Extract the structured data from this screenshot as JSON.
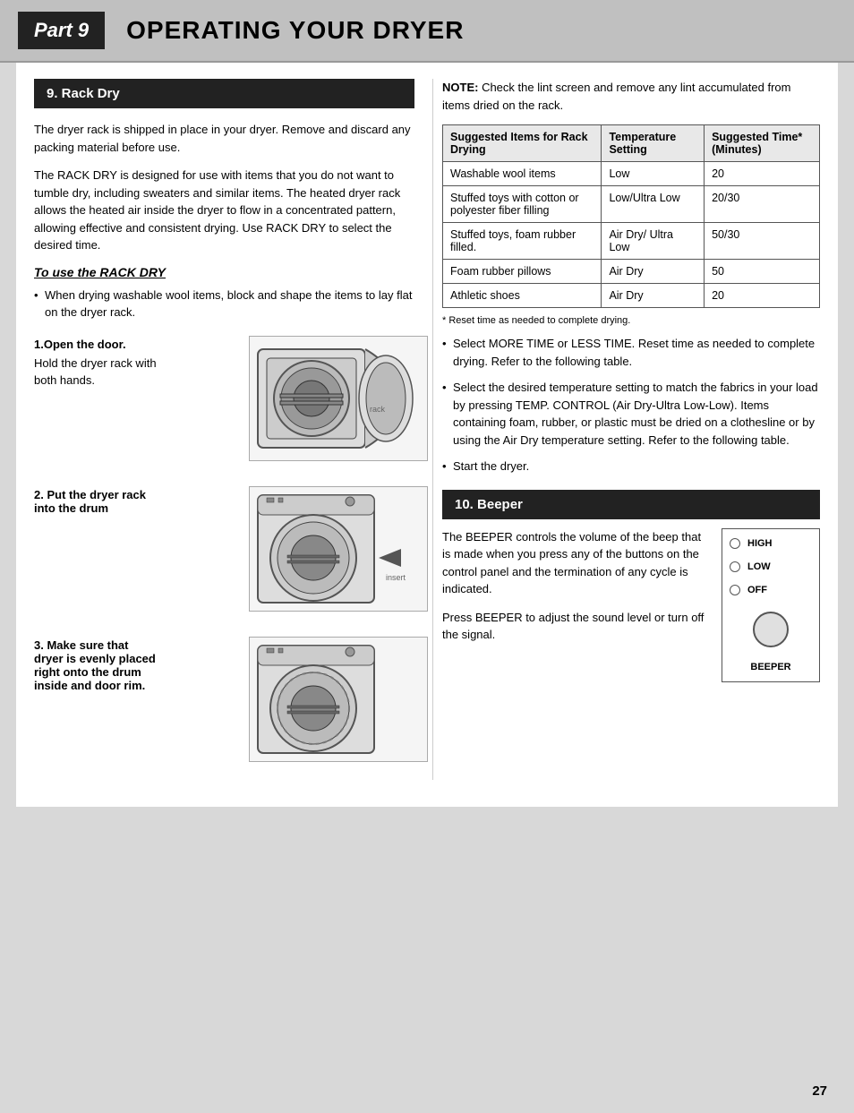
{
  "header": {
    "part_label": "Part 9",
    "title": "OPERATING YOUR DRYER"
  },
  "section1": {
    "heading": "9. Rack Dry",
    "para1": "The dryer rack is shipped in place in your dryer. Remove and discard any packing material before use.",
    "para2": "The RACK DRY is designed for use with items that you do not want to tumble dry, including sweaters and similar items.  The heated dryer rack allows the heated air inside the dryer to flow in a concentrated pattern, allowing effective and consistent drying. Use RACK DRY to select the desired time.",
    "use_heading": "To use the RACK DRY",
    "bullet1": "When drying washable wool items, block and shape the items to lay flat on the dryer rack.",
    "step1_label": "1.Open the door.",
    "step1_text": "Hold the dryer rack with both hands.",
    "step2_label": "2. Put the dryer rack into the drum",
    "step3_label": "3. Make sure that dryer is evenly placed right onto the drum inside and door rim."
  },
  "right_col": {
    "note_bold": "NOTE:",
    "note_text": " Check the lint screen and remove any lint accumulated from items dried on the rack.",
    "table": {
      "col1": "Suggested Items for Rack Drying",
      "col2": "Temperature Setting",
      "col3": "Suggested Time* (Minutes)",
      "rows": [
        {
          "item": "Washable wool items",
          "temp": "Low",
          "time": "20"
        },
        {
          "item": "Stuffed toys with cotton or polyester fiber filling",
          "temp": "Low/Ultra Low",
          "time": "20/30"
        },
        {
          "item": "Stuffed toys, foam rubber filled.",
          "temp": "Air Dry/ Ultra Low",
          "time": "50/30"
        },
        {
          "item": "Foam rubber pillows",
          "temp": "Air Dry",
          "time": "50"
        },
        {
          "item": "Athletic shoes",
          "temp": "Air Dry",
          "time": "20"
        }
      ]
    },
    "footnote": "* Reset time as needed to complete drying.",
    "bullet1": "Select MORE TIME or LESS TIME. Reset time as needed to complete drying.  Refer to the following table.",
    "bullet2": "Select the desired temperature setting to match the fabrics in your load by pressing TEMP.  CONTROL (Air Dry-Ultra Low-Low). Items containing foam, rubber, or plastic must be dried on a clothesline or by using the Air Dry temperature setting. Refer to the following table.",
    "bullet3": "Start the dryer."
  },
  "section2": {
    "heading": "10. Beeper",
    "para1": "The BEEPER controls the volume of the beep that is made when you press any of the buttons on the control panel and the termination of any cycle is indicated.",
    "para2": "Press BEEPER to adjust the sound level or turn off the signal.",
    "high_label": "HIGH",
    "low_label": "LOW",
    "off_label": "OFF",
    "knob_label": "BEEPER"
  },
  "page_number": "27"
}
